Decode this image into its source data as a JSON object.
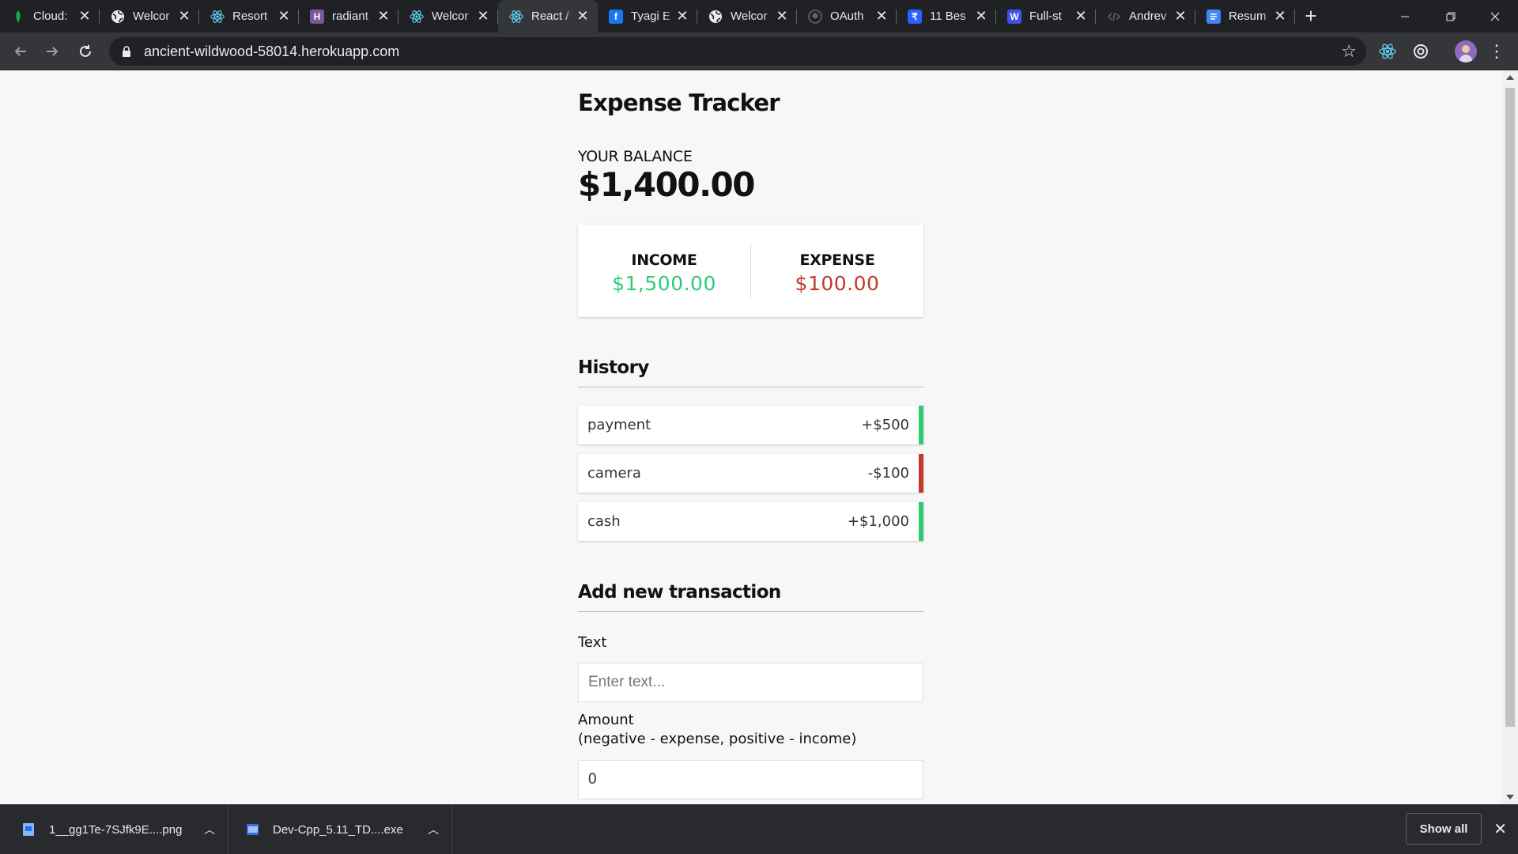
{
  "browser": {
    "tabs": [
      {
        "title": "Cloud:",
        "icon": "mongodb-leaf-icon",
        "color": "#13aa52",
        "active": false
      },
      {
        "title": "Welcor",
        "icon": "globe-icon",
        "color": "#e8eaed",
        "active": false
      },
      {
        "title": "Resort",
        "icon": "react-icon",
        "color": "#61dafb",
        "active": false
      },
      {
        "title": "radiant",
        "icon": "heroku-icon",
        "color": "#79589f",
        "active": false
      },
      {
        "title": "Welcor",
        "icon": "react-icon",
        "color": "#61dafb",
        "active": false
      },
      {
        "title": "React /",
        "icon": "react-icon",
        "color": "#61dafb",
        "active": true
      },
      {
        "title": "Tyagi E",
        "icon": "facebook-icon",
        "color": "#1877f2",
        "active": false
      },
      {
        "title": "Welcor",
        "icon": "globe-icon",
        "color": "#e8eaed",
        "active": false
      },
      {
        "title": "OAuth",
        "icon": "github-icon",
        "color": "#e8eaed",
        "active": false
      },
      {
        "title": "11 Bes",
        "icon": "bookmark-app-icon",
        "color": "#2962ff",
        "active": false
      },
      {
        "title": "Full-st",
        "icon": "w-logo-icon",
        "color": "#3f51e6",
        "active": false
      },
      {
        "title": "Andrev",
        "icon": "code-icon",
        "color": "#9aa0a6",
        "active": false
      },
      {
        "title": "Resum",
        "icon": "docs-icon",
        "color": "#4285f4",
        "active": false
      }
    ],
    "url": "ancient-wildwood-58014.herokuapp.com"
  },
  "app": {
    "title": "Expense Tracker",
    "balance_label": "YOUR BALANCE",
    "balance": "$1,400.00",
    "income_label": "INCOME",
    "income": "$1,500.00",
    "expense_label": "EXPENSE",
    "expense": "$100.00",
    "history_title": "History",
    "transactions": [
      {
        "text": "payment",
        "amount": "+$500",
        "type": "plus"
      },
      {
        "text": "camera",
        "amount": "-$100",
        "type": "minus"
      },
      {
        "text": "cash",
        "amount": "+$1,000",
        "type": "plus"
      }
    ],
    "add_title": "Add new transaction",
    "text_label": "Text",
    "text_placeholder": "Enter text...",
    "amount_label_line1": "Amount",
    "amount_label_line2": "(negative - expense, positive - income)",
    "amount_value": "0"
  },
  "colors": {
    "income": "#2ecc71",
    "expense": "#c0392b"
  },
  "downloads": {
    "items": [
      {
        "name": "1__gg1Te-7SJfk9E....png",
        "icon": "image-file-icon"
      },
      {
        "name": "Dev-Cpp_5.11_TD....exe",
        "icon": "exe-file-icon"
      }
    ],
    "show_all": "Show all"
  }
}
